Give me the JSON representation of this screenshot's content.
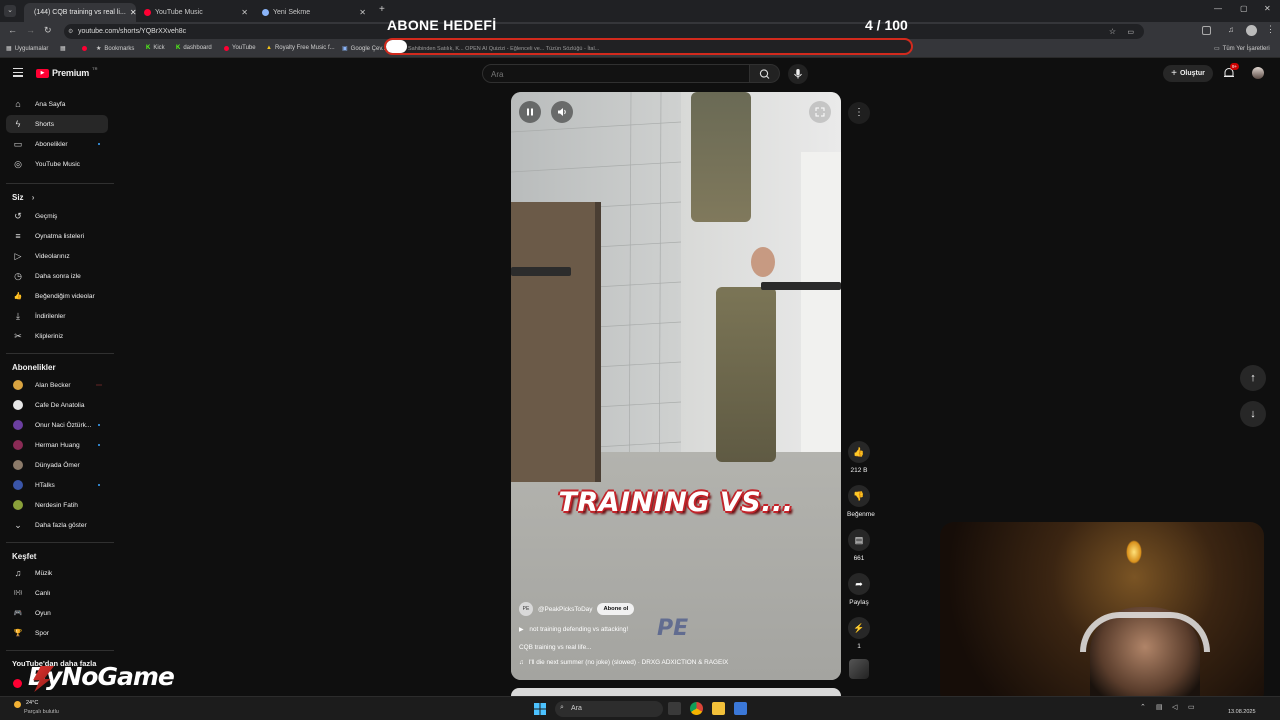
{
  "browser": {
    "tabs": [
      {
        "label": "(144) CQB training vs real li...",
        "active": true
      },
      {
        "label": "YouTube Music",
        "active": false
      },
      {
        "label": "Yeni Sekme",
        "active": false
      }
    ],
    "new_tab": "+",
    "url": "youtube.com/shorts/YQBrXXveh8c",
    "bookmarks": [
      {
        "label": "Uygulamalar"
      },
      {
        "label": "Bookmarks"
      },
      {
        "label": "Kick"
      },
      {
        "label": "dashboard"
      },
      {
        "label": "YouTube"
      },
      {
        "label": "Royalty Free Music f..."
      },
      {
        "label": "Google Çev..."
      }
    ],
    "bookmarks_hidden_tail": "Sahibinden Satılık, K...   OPEN AI   Quizizi - Eğlenceli ve...   Tüzün Sözlüğü - İtal...",
    "all_bookmarks": "Tüm Yer İşaretleri"
  },
  "overlay": {
    "goal_title": "ABONE HEDEFİ",
    "goal_count": "4  / 100",
    "goal_progress": 0.04,
    "logo": "ByNoGame"
  },
  "masthead": {
    "brand": "Premium",
    "brand_superscript": "TR",
    "search_placeholder": "Ara",
    "create_label": "Oluştur",
    "notif_badge": "9+"
  },
  "sidebar": {
    "main": [
      {
        "label": "Ana Sayfa",
        "icon": "home-icon",
        "glyph": "⌂"
      },
      {
        "label": "Shorts",
        "icon": "shorts-icon",
        "glyph": "ϟ",
        "selected": true
      },
      {
        "label": "Abonelikler",
        "icon": "subscriptions-icon",
        "glyph": "▭",
        "dot": true
      },
      {
        "label": "YouTube Music",
        "icon": "music-icon",
        "glyph": "◎"
      }
    ],
    "you_heading": "Siz",
    "you": [
      {
        "label": "Geçmiş",
        "icon": "history-icon",
        "glyph": "↺"
      },
      {
        "label": "Oynatma listeleri",
        "icon": "playlist-icon",
        "glyph": "≡"
      },
      {
        "label": "Videolarınız",
        "icon": "your-videos-icon",
        "glyph": "▷"
      },
      {
        "label": "Daha sonra izle",
        "icon": "watch-later-icon",
        "glyph": "◷"
      },
      {
        "label": "Beğendiğim videolar",
        "icon": "liked-icon",
        "glyph": "👍"
      },
      {
        "label": "İndirilenler",
        "icon": "download-icon",
        "glyph": "⤓"
      },
      {
        "label": "Klipleriniz",
        "icon": "clips-icon",
        "glyph": "✂"
      }
    ],
    "subs_heading": "Abonelikler",
    "subs": [
      {
        "label": "Alan Becker",
        "color": "#d9a441",
        "dot": "live"
      },
      {
        "label": "Cafe De Anatolia",
        "color": "#e8e8e8"
      },
      {
        "label": "Onur Naci Öztürk...",
        "color": "#6b3fa0",
        "dot": "new"
      },
      {
        "label": "Herman Huang",
        "color": "#8a2b55",
        "dot": "new"
      },
      {
        "label": "Dünyada Ömer",
        "color": "#8c7b6a"
      },
      {
        "label": "HTalks",
        "color": "#3a55a8",
        "dot": "new"
      },
      {
        "label": "Nerdesin Fatih",
        "color": "#8aa03a"
      },
      {
        "label": "Daha fazla göster",
        "color": "",
        "chevron": true
      }
    ],
    "explore_heading": "Keşfet",
    "explore": [
      {
        "label": "Müzik",
        "icon": "music-note-icon",
        "glyph": "♫"
      },
      {
        "label": "Canlı",
        "icon": "live-icon",
        "glyph": "((•))"
      },
      {
        "label": "Oyun",
        "icon": "gaming-icon",
        "glyph": "🎮"
      },
      {
        "label": "Spor",
        "icon": "trophy-icon",
        "glyph": "🏆"
      }
    ],
    "more_heading": "YouTube'dan daha fazla"
  },
  "short": {
    "caption": "TRAINING VS...",
    "channel": "@PeakPicksToDay",
    "channel_initials": "PE",
    "subscribe": "Abone ol",
    "pinned": "not training defending vs attacking!",
    "title": "CQB training vs real life...",
    "audio": "I'll die next summer (no joke) (slowed) · DRXG ADXICTION & RAGEIX"
  },
  "actions": [
    {
      "name": "like",
      "glyph": "👍",
      "label": "212 B"
    },
    {
      "name": "dislike",
      "glyph": "👎",
      "label": "Beğenme"
    },
    {
      "name": "comments",
      "glyph": "▤",
      "label": "661"
    },
    {
      "name": "share",
      "glyph": "➦",
      "label": "Paylaş"
    },
    {
      "name": "remix",
      "glyph": "⚡",
      "label": "1"
    }
  ],
  "taskbar": {
    "weather_temp": "24°C",
    "weather_desc": "Parçalı bulutlu",
    "search": "Ara",
    "time": "",
    "date": "13.08.2025"
  },
  "colors": {
    "accent_red": "#d22a1d",
    "yt_red": "#ff0033",
    "selected_bg": "#272727"
  }
}
